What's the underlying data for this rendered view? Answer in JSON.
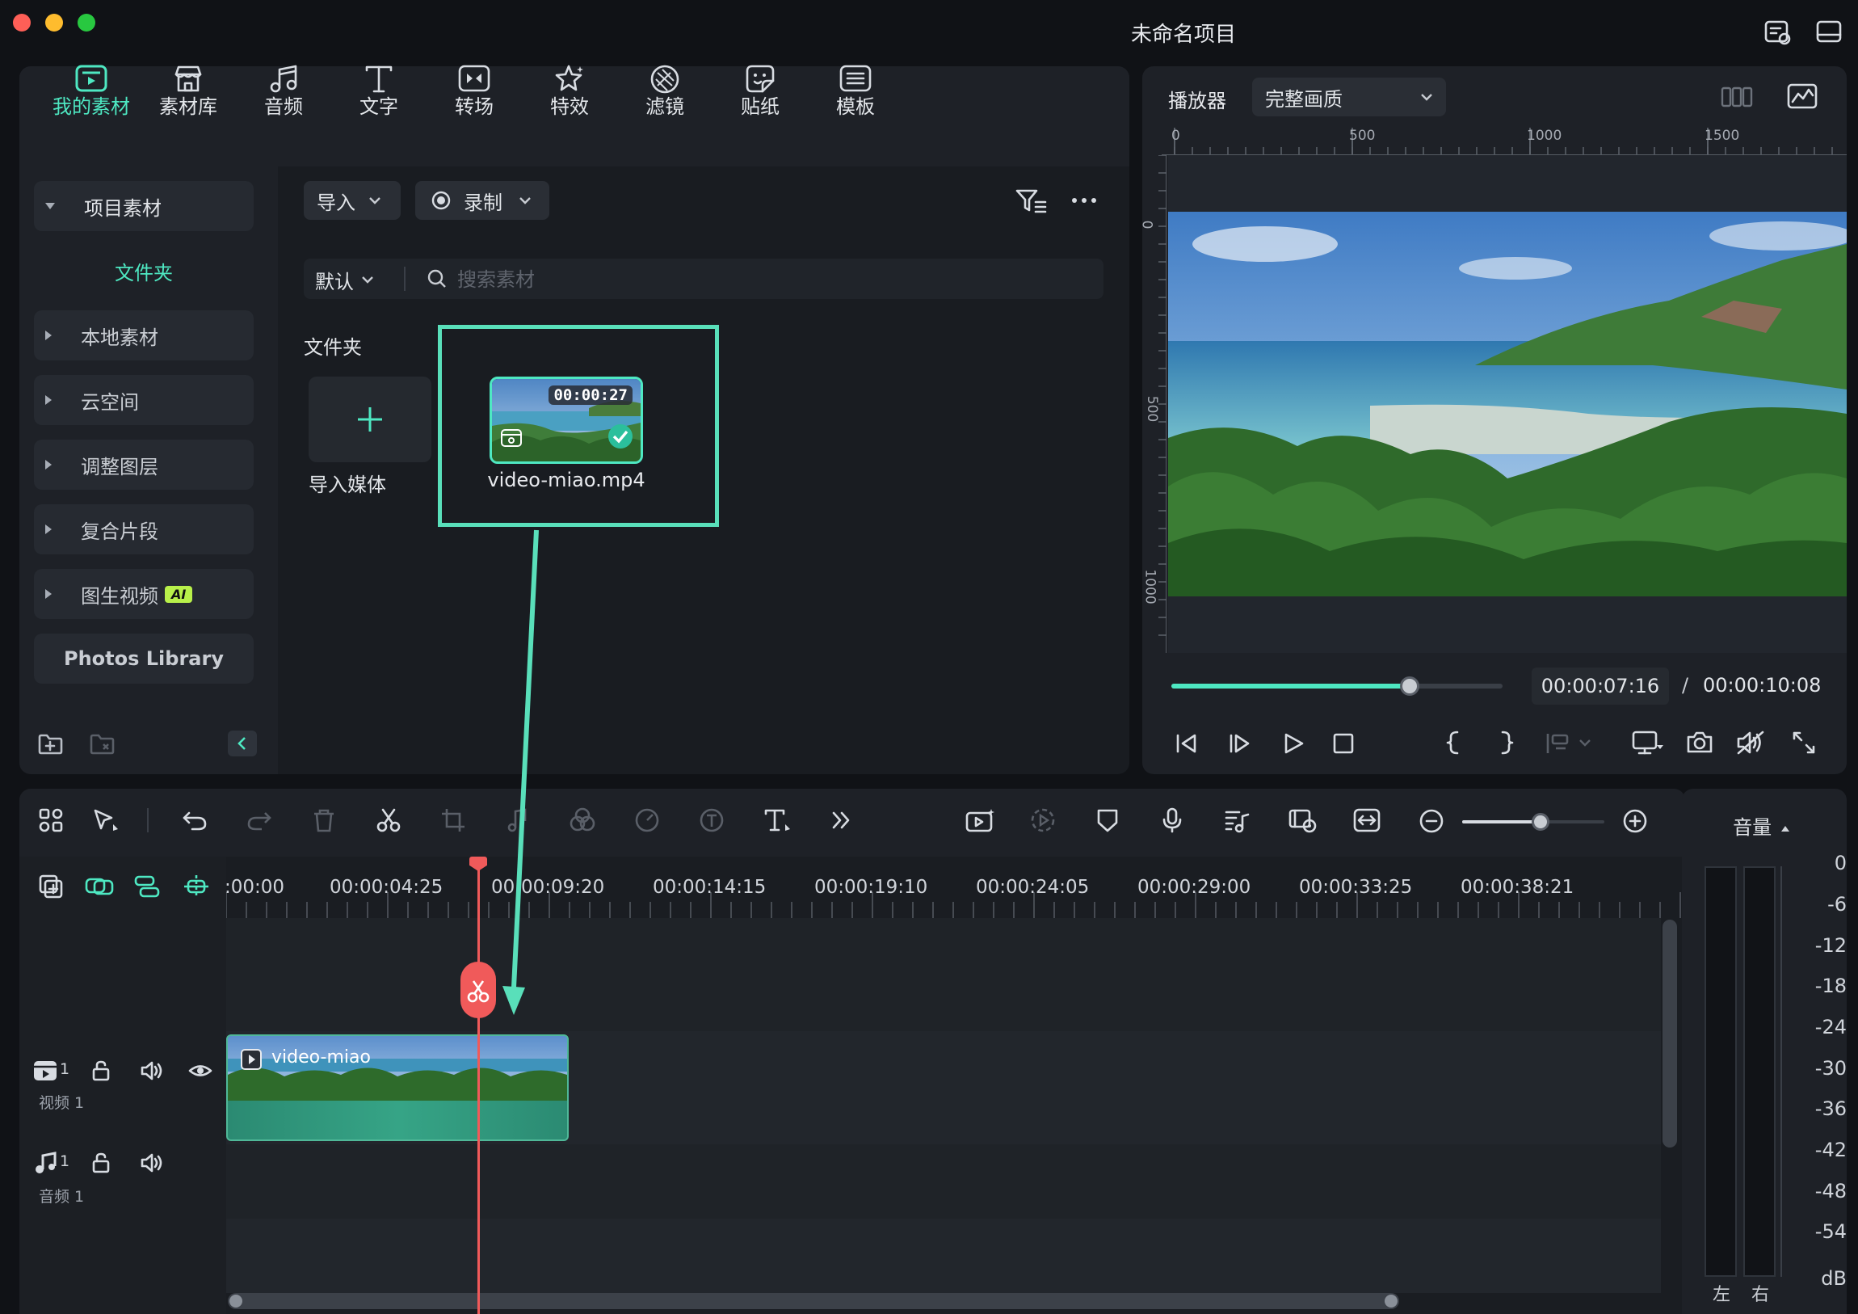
{
  "window": {
    "title": "未命名项目"
  },
  "media_tabs": [
    {
      "label": "我的素材",
      "icon": "my-media-icon",
      "active": true
    },
    {
      "label": "素材库",
      "icon": "stock-library-icon"
    },
    {
      "label": "音频",
      "icon": "music-note-icon"
    },
    {
      "label": "文字",
      "icon": "text-t-icon"
    },
    {
      "label": "转场",
      "icon": "transition-icon"
    },
    {
      "label": "特效",
      "icon": "effects-icon"
    },
    {
      "label": "滤镜",
      "icon": "filter-icon"
    },
    {
      "label": "贴纸",
      "icon": "sticker-icon"
    },
    {
      "label": "模板",
      "icon": "template-icon"
    }
  ],
  "sidebar": {
    "project_media": "项目素材",
    "folder": "文件夹",
    "items": [
      "本地素材",
      "云空间",
      "调整图层",
      "复合片段",
      "图生视频"
    ],
    "ai_badge": "AI",
    "photos": "Photos Library"
  },
  "media_toolbar": {
    "import": "导入",
    "record": "录制",
    "sort": "默认",
    "search_placeholder": "搜索素材"
  },
  "media_area": {
    "folder_label": "文件夹",
    "import_media": "导入媒体",
    "clip_name": "video-miao.mp4",
    "clip_duration": "00:00:27"
  },
  "player": {
    "label": "播放器",
    "quality": "完整画质",
    "ruler_h": [
      "0",
      "500",
      "1000",
      "1500"
    ],
    "ruler_v": [
      "0",
      "500",
      "1000"
    ],
    "current_time": "00:00:07:16",
    "separator": "/",
    "total_time": "00:00:10:08",
    "progress": 0.72
  },
  "timeline": {
    "timecodes": [
      ":00:00",
      "00:00:04:25",
      "00:00:09:20",
      "00:00:14:15",
      "00:00:19:10",
      "00:00:24:05",
      "00:00:29:00",
      "00:00:33:25",
      "00:00:38:21"
    ],
    "video_track": {
      "label": "视频 1",
      "number": "1",
      "clip_label": "video-miao"
    },
    "audio_track": {
      "label": "音频 1",
      "number": "1"
    },
    "zoom": 0.55
  },
  "volume_meter": {
    "title": "音量",
    "scale": [
      "0",
      "-6",
      "-12",
      "-18",
      "-24",
      "-30",
      "-36",
      "-42",
      "-48",
      "-54",
      "dB"
    ],
    "left": "左",
    "right": "右"
  },
  "colors": {
    "accent": "#4ee8c2",
    "playhead": "#f05a5a",
    "clip": "#2f9a80"
  }
}
